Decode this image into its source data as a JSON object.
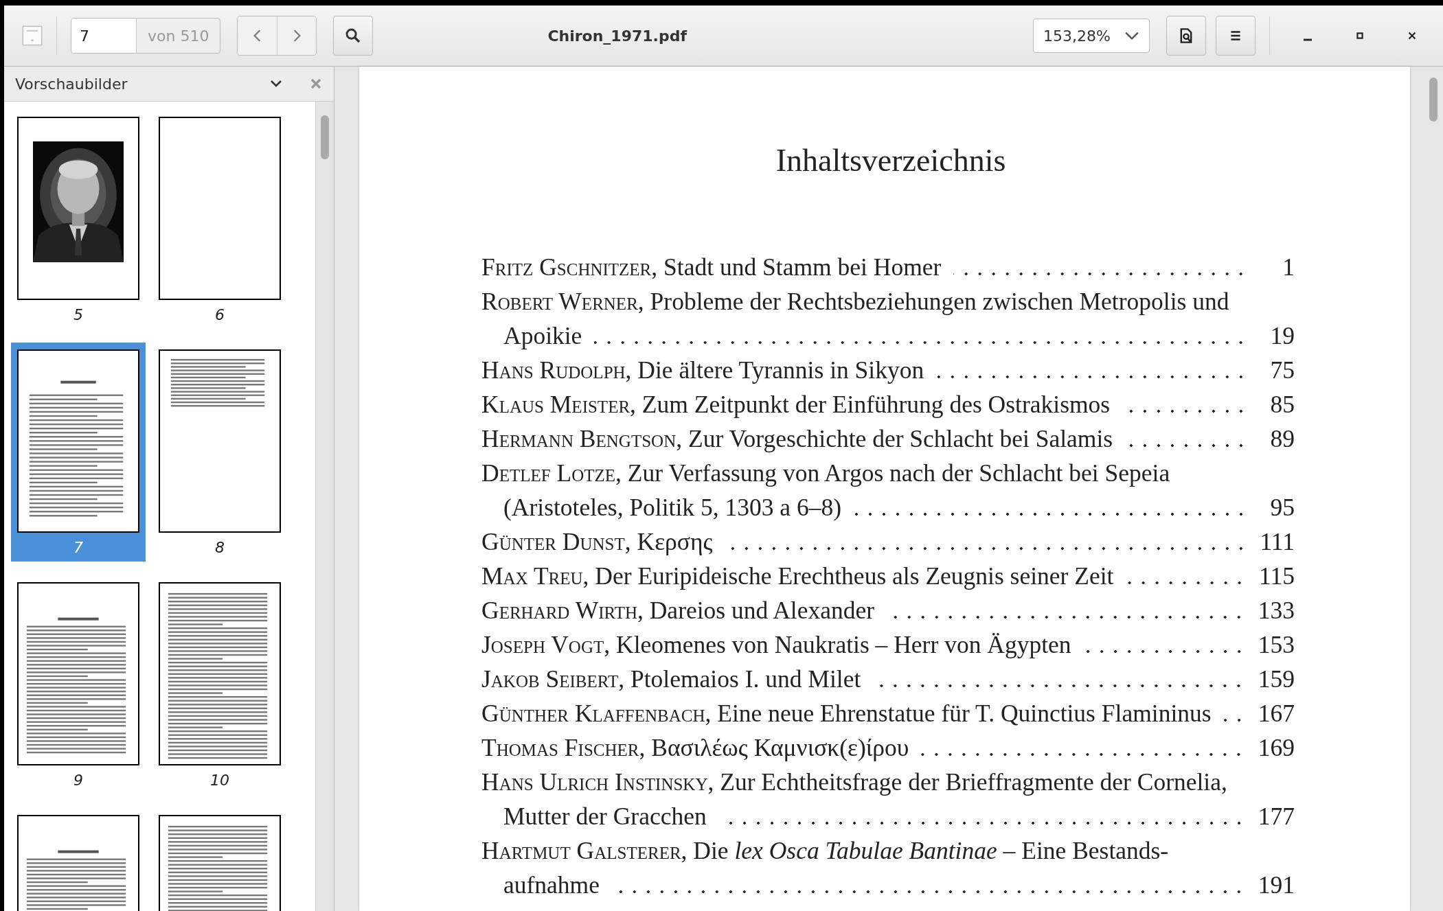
{
  "window": {
    "title": "Chiron_1971.pdf"
  },
  "toolbar": {
    "page_field": {
      "value": "7"
    },
    "page_total": "von 510",
    "zoom": "153,28%"
  },
  "sidebar": {
    "title": "Vorschaubilder",
    "thumbnails": [
      {
        "label": "5",
        "kind": "portrait",
        "selected": false
      },
      {
        "label": "6",
        "kind": "blank",
        "selected": false
      },
      {
        "label": "7",
        "kind": "toc",
        "selected": true
      },
      {
        "label": "8",
        "kind": "toc_short",
        "selected": false
      },
      {
        "label": "9",
        "kind": "article",
        "selected": false
      },
      {
        "label": "10",
        "kind": "text",
        "selected": false
      },
      {
        "kind": "article",
        "selected": false
      },
      {
        "kind": "text",
        "selected": false
      }
    ]
  },
  "document": {
    "heading": "Inhaltsverzeichnis",
    "entries": [
      {
        "author": "Fritz Gschnitzer,",
        "title": "Stadt und Stamm bei Homer",
        "page": "1"
      },
      {
        "author": "Robert Werner,",
        "title": "Probleme der Rechtsbeziehungen zwischen Metropolis und",
        "continuation": "Apoikie",
        "page": "19"
      },
      {
        "author": "Hans Rudolph,",
        "title": "Die ältere Tyrannis in Sikyon",
        "page": "75"
      },
      {
        "author": "Klaus Meister,",
        "title": "Zum Zeitpunkt der Einführung des Ostrakismos",
        "page": "85"
      },
      {
        "author": "Hermann Bengtson,",
        "title": "Zur Vorgeschichte der Schlacht bei Salamis",
        "page": "89"
      },
      {
        "author": "Detlef Lotze,",
        "title": "Zur Verfassung von Argos nach der Schlacht bei Sepeia",
        "continuation": "(Aristoteles, Politik 5, 1303 a 6–8)",
        "page": "95"
      },
      {
        "author": "Günter Dunst,",
        "title": "Κερσης",
        "page": "111"
      },
      {
        "author": "Max Treu,",
        "title": "Der Euripideische Erechtheus als Zeugnis seiner Zeit",
        "page": "115"
      },
      {
        "author": "Gerhard Wirth,",
        "title": "Dareios und Alexander",
        "page": "133"
      },
      {
        "author": "Joseph Vogt,",
        "title": "Kleomenes von Naukratis – Herr von Ägypten",
        "page": "153"
      },
      {
        "author": "Jakob Seibert,",
        "title": "Ptolemaios I. und Milet",
        "page": "159"
      },
      {
        "author": "Günther Klaffenbach,",
        "title": "Eine neue Ehrenstatue für T. Quinctius Flamininus",
        "page": "167"
      },
      {
        "author": "Thomas Fischer,",
        "title": "Βασιλέως Καμνισκ(ε)ίρου",
        "page": "169"
      },
      {
        "author": "Hans Ulrich Instinsky,",
        "title": "Zur Echtheitsfrage der Brieffragmente der Cornelia,",
        "continuation": "Mutter der Gracchen",
        "page": "177"
      },
      {
        "author": "Hartmut Galsterer,",
        "title": "Die *lex Osca Tabulae Bantinae* – Eine Bestands-",
        "continuation": "aufnahme",
        "page": "191"
      }
    ]
  }
}
